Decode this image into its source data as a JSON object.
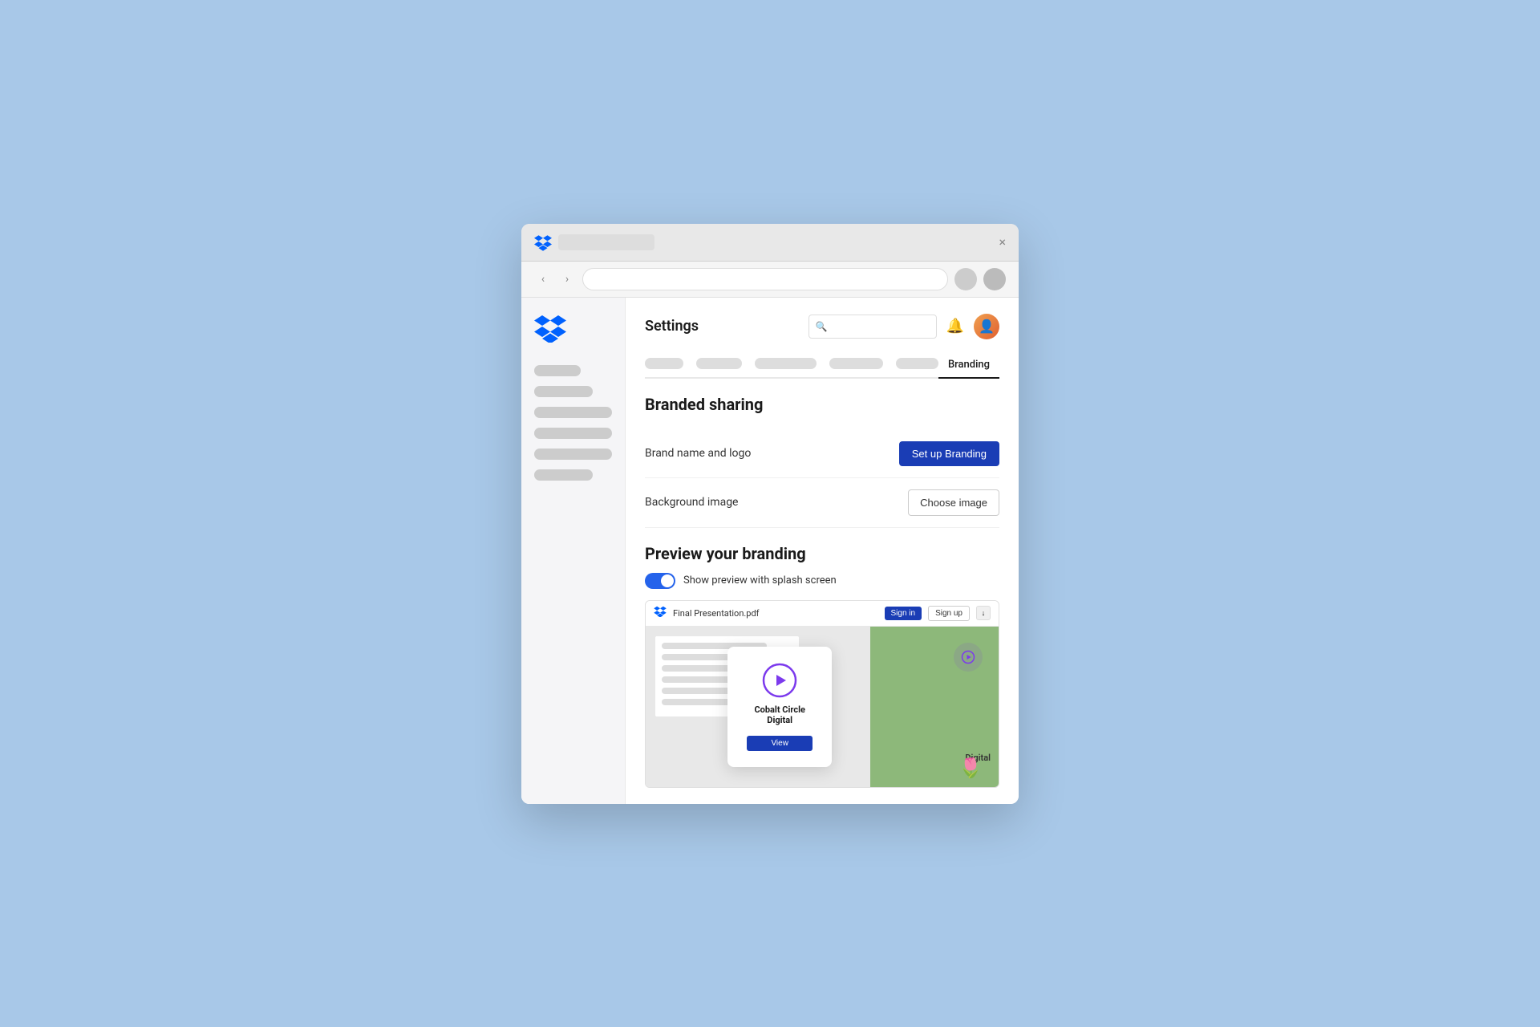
{
  "browser": {
    "close_label": "×",
    "back_label": "‹",
    "forward_label": "›"
  },
  "header": {
    "title": "Settings",
    "search_placeholder": "Search",
    "tabs": [
      {
        "label": "Branding",
        "active": true
      }
    ]
  },
  "branding": {
    "section_title": "Branded sharing",
    "brand_name_label": "Brand name and logo",
    "setup_button_label": "Set up Branding",
    "background_label": "Background image",
    "choose_image_label": "Choose image"
  },
  "preview": {
    "section_title": "Preview your branding",
    "toggle_label": "Show preview with splash screen",
    "toggle_on": true,
    "filename": "Final Presentation.pdf",
    "signin_label": "Sign in",
    "signup_label": "Sign up",
    "company_name": "Cobalt Circle Digital",
    "view_button_label": "View",
    "digital_label": "Digital"
  },
  "sidebar": {
    "items": []
  }
}
